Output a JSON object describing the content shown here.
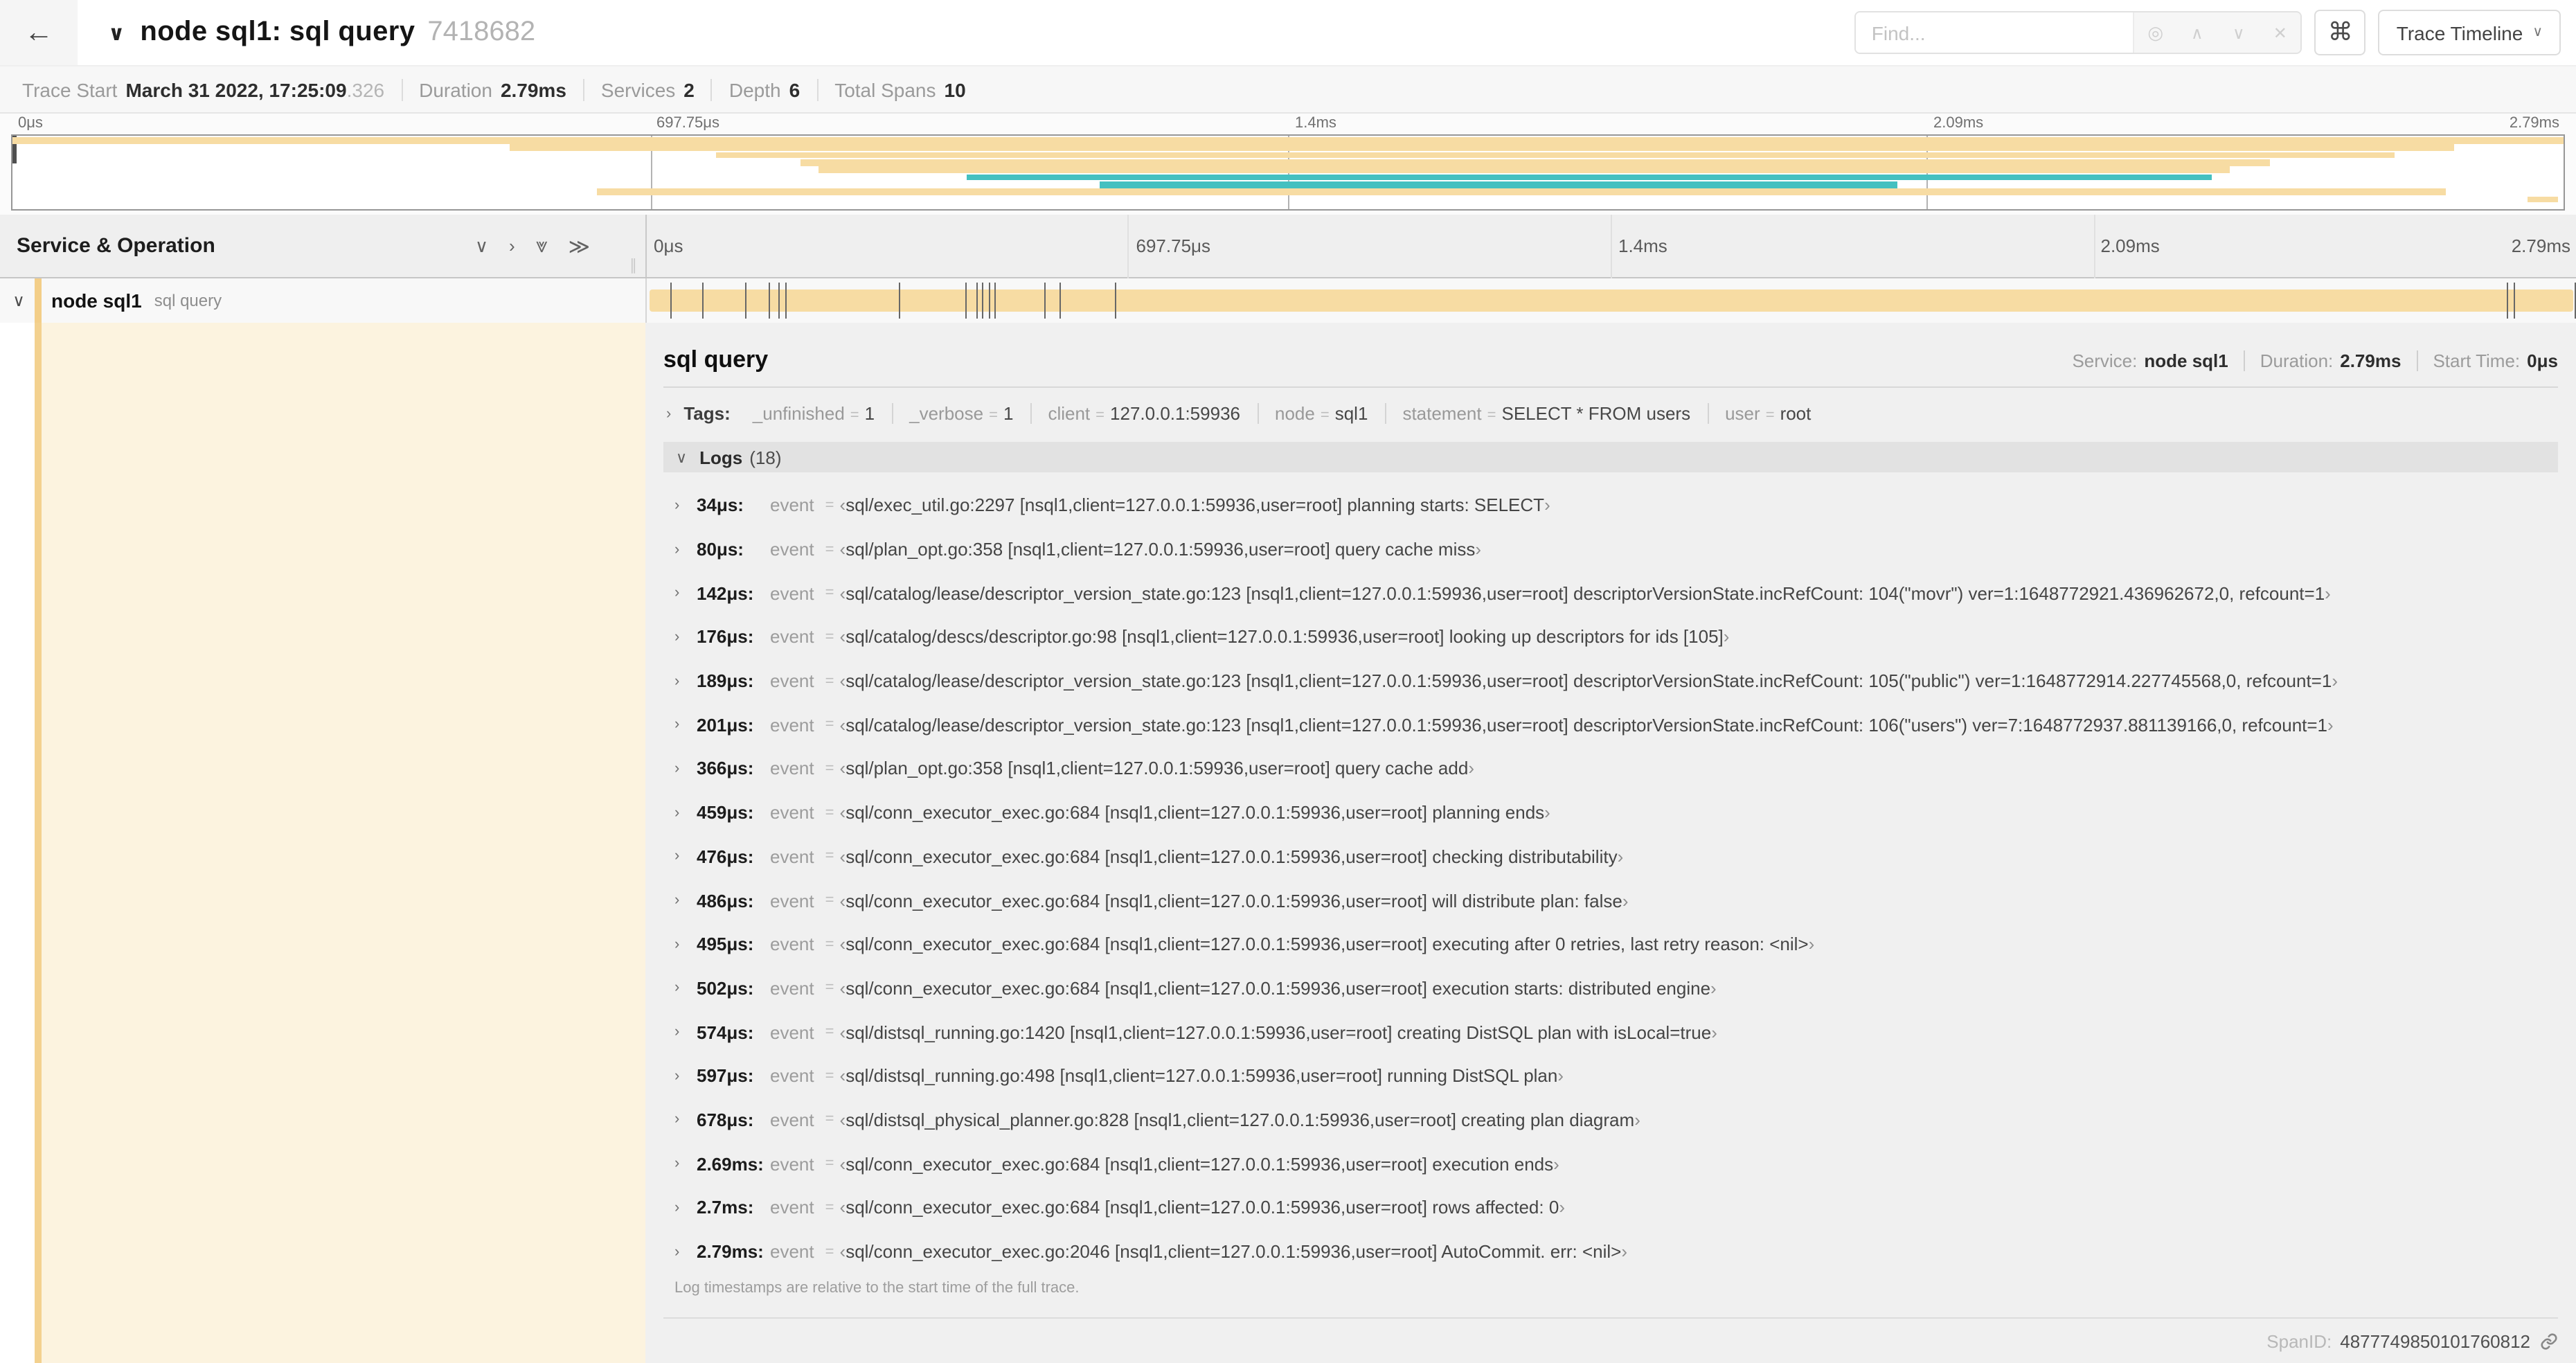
{
  "header": {
    "title": "node sql1: sql query",
    "trace_id": "7418682",
    "find_placeholder": "Find...",
    "view_selector_label": "Trace Timeline"
  },
  "icons": {
    "back": "←",
    "title_chevron": "∨",
    "locate": "◎",
    "prev": "∧",
    "next": "∨",
    "close": "✕",
    "command": "⌘",
    "dropdown": "∨",
    "collapse_one": "∨",
    "expand_one": "›",
    "collapse_all": "⩔",
    "expand_all": "≫",
    "resize": "∥",
    "row_twistie": "∨",
    "tags_twistie": "›",
    "logs_twistie": "∨",
    "log_twistie": "›"
  },
  "summary": {
    "trace_start_label": "Trace Start",
    "trace_start": "March 31 2022, 17:25:09",
    "trace_start_fraction": ".326",
    "duration_label": "Duration",
    "duration": "2.79ms",
    "services_label": "Services",
    "services": "2",
    "depth_label": "Depth",
    "depth": "6",
    "total_spans_label": "Total Spans",
    "total_spans": "10"
  },
  "minimap": {
    "ruler": [
      "0μs",
      "697.75μs",
      "1.4ms",
      "2.09ms",
      "2.79ms"
    ],
    "ruler_percents": [
      0,
      25,
      50,
      75,
      100
    ],
    "bars": [
      {
        "row": 0,
        "left": 0,
        "width": 100,
        "color": "#F7DCA3"
      },
      {
        "row": 1,
        "left": 19.5,
        "width": 76.2,
        "color": "#F7DCA3"
      },
      {
        "row": 2,
        "left": 27.6,
        "width": 65.8,
        "color": "#F7DCA3"
      },
      {
        "row": 3,
        "left": 30.9,
        "width": 57.6,
        "color": "#F7DCA3"
      },
      {
        "row": 4,
        "left": 31.6,
        "width": 55.3,
        "color": "#F7DCA3"
      },
      {
        "row": 5,
        "left": 37.4,
        "width": 48.8,
        "color": "#44C0C0"
      },
      {
        "row": 6,
        "left": 42.6,
        "width": 31.3,
        "color": "#44C0C0"
      },
      {
        "row": 7,
        "left": 22.9,
        "width": 72.5,
        "color": "#F7DCA3"
      },
      {
        "row": 8,
        "left": 98.6,
        "width": 1.2,
        "color": "#F7DCA3"
      }
    ]
  },
  "timeline": {
    "column_header": "Service & Operation",
    "ruler": [
      "0μs",
      "697.75μs",
      "1.4ms",
      "2.09ms",
      "2.79ms"
    ],
    "ruler_percents": [
      0,
      25,
      50,
      75,
      100
    ],
    "span_row": {
      "service": "node sql1",
      "operation": "sql query",
      "bar_color": "#F7DCA3",
      "log_tick_percents": [
        1.2,
        2.9,
        5.1,
        6.3,
        6.8,
        7.2,
        13.1,
        16.5,
        17.1,
        17.4,
        17.7,
        18.0,
        20.6,
        21.4,
        24.3,
        96.4,
        96.8,
        99.9
      ]
    }
  },
  "detail": {
    "operation": "sql query",
    "service_label": "Service:",
    "service": "node sql1",
    "duration_label": "Duration:",
    "duration": "2.79ms",
    "start_time_label": "Start Time:",
    "start_time": "0μs",
    "tags_label": "Tags:",
    "tags": [
      {
        "key": "_unfinished",
        "value": "1"
      },
      {
        "key": "_verbose",
        "value": "1"
      },
      {
        "key": "client",
        "value": "127.0.0.1:59936"
      },
      {
        "key": "node",
        "value": "sql1"
      },
      {
        "key": "statement",
        "value": "SELECT * FROM users"
      },
      {
        "key": "user",
        "value": "root"
      }
    ],
    "logs_label": "Logs",
    "logs_count": "(18)",
    "log_key": "event",
    "logs": [
      {
        "time": "34μs:",
        "value": "sql/exec_util.go:2297 [nsql1,client=127.0.0.1:59936,user=root] planning starts: SELECT"
      },
      {
        "time": "80μs:",
        "value": "sql/plan_opt.go:358 [nsql1,client=127.0.0.1:59936,user=root] query cache miss"
      },
      {
        "time": "142μs:",
        "value": "sql/catalog/lease/descriptor_version_state.go:123 [nsql1,client=127.0.0.1:59936,user=root] descriptorVersionState.incRefCount: 104(\"movr\") ver=1:1648772921.436962672,0, refcount=1"
      },
      {
        "time": "176μs:",
        "value": "sql/catalog/descs/descriptor.go:98 [nsql1,client=127.0.0.1:59936,user=root] looking up descriptors for ids [105]"
      },
      {
        "time": "189μs:",
        "value": "sql/catalog/lease/descriptor_version_state.go:123 [nsql1,client=127.0.0.1:59936,user=root] descriptorVersionState.incRefCount: 105(\"public\") ver=1:1648772914.227745568,0, refcount=1"
      },
      {
        "time": "201μs:",
        "value": "sql/catalog/lease/descriptor_version_state.go:123 [nsql1,client=127.0.0.1:59936,user=root] descriptorVersionState.incRefCount: 106(\"users\") ver=7:1648772937.881139166,0, refcount=1"
      },
      {
        "time": "366μs:",
        "value": "sql/plan_opt.go:358 [nsql1,client=127.0.0.1:59936,user=root] query cache add"
      },
      {
        "time": "459μs:",
        "value": "sql/conn_executor_exec.go:684 [nsql1,client=127.0.0.1:59936,user=root] planning ends"
      },
      {
        "time": "476μs:",
        "value": "sql/conn_executor_exec.go:684 [nsql1,client=127.0.0.1:59936,user=root] checking distributability"
      },
      {
        "time": "486μs:",
        "value": "sql/conn_executor_exec.go:684 [nsql1,client=127.0.0.1:59936,user=root] will distribute plan: false"
      },
      {
        "time": "495μs:",
        "value": "sql/conn_executor_exec.go:684 [nsql1,client=127.0.0.1:59936,user=root] executing after 0 retries, last retry reason: <nil>"
      },
      {
        "time": "502μs:",
        "value": "sql/conn_executor_exec.go:684 [nsql1,client=127.0.0.1:59936,user=root] execution starts: distributed engine"
      },
      {
        "time": "574μs:",
        "value": "sql/distsql_running.go:1420 [nsql1,client=127.0.0.1:59936,user=root] creating DistSQL plan with isLocal=true"
      },
      {
        "time": "597μs:",
        "value": "sql/distsql_running.go:498 [nsql1,client=127.0.0.1:59936,user=root] running DistSQL plan"
      },
      {
        "time": "678μs:",
        "value": "sql/distsql_physical_planner.go:828 [nsql1,client=127.0.0.1:59936,user=root] creating plan diagram"
      },
      {
        "time": "2.69ms:",
        "value": "sql/conn_executor_exec.go:684 [nsql1,client=127.0.0.1:59936,user=root] execution ends"
      },
      {
        "time": "2.7ms:",
        "value": "sql/conn_executor_exec.go:684 [nsql1,client=127.0.0.1:59936,user=root] rows affected: 0"
      },
      {
        "time": "2.79ms:",
        "value": "sql/conn_executor_exec.go:2046 [nsql1,client=127.0.0.1:59936,user=root] AutoCommit. err: <nil>"
      }
    ],
    "logs_note": "Log timestamps are relative to the start time of the full trace.",
    "span_id_label": "SpanID:",
    "span_id": "4877749850101760812"
  },
  "misc": {
    "eq": "=",
    "open_quote": "‹",
    "close_quote": "›"
  },
  "colors": {
    "span_tan": "#F7DCA3",
    "span_teal": "#44C0C0",
    "detail_cream": "#FCF3DF",
    "detail_stripe": "#F3D18F"
  }
}
